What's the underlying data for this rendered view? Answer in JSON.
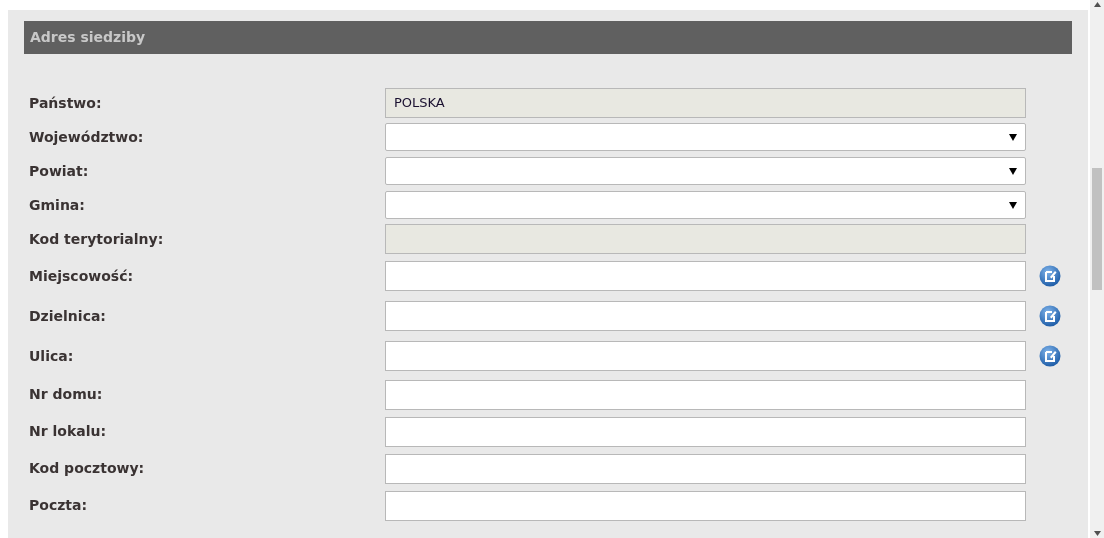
{
  "section": {
    "title": "Adres siedziby"
  },
  "fields": [
    {
      "label": "Państwo:",
      "kind": "readonly",
      "value": "POLSKA",
      "action": false
    },
    {
      "label": "Województwo:",
      "kind": "select",
      "action": false
    },
    {
      "label": "Powiat:",
      "kind": "select",
      "action": false
    },
    {
      "label": "Gmina:",
      "kind": "select",
      "action": false
    },
    {
      "label": "Kod terytorialny:",
      "kind": "readonly",
      "action": false
    },
    {
      "label": "Miejscowość:",
      "kind": "text",
      "action": true
    },
    {
      "label": "Dzielnica:",
      "kind": "text",
      "action": true
    },
    {
      "label": "Ulica:",
      "kind": "text",
      "action": true
    },
    {
      "label": "Nr domu:",
      "kind": "text",
      "action": false
    },
    {
      "label": "Nr lokalu:",
      "kind": "text",
      "action": false
    },
    {
      "label": "Kod pocztowy:",
      "kind": "text",
      "action": false
    },
    {
      "label": "Poczta:",
      "kind": "text",
      "action": false
    }
  ]
}
